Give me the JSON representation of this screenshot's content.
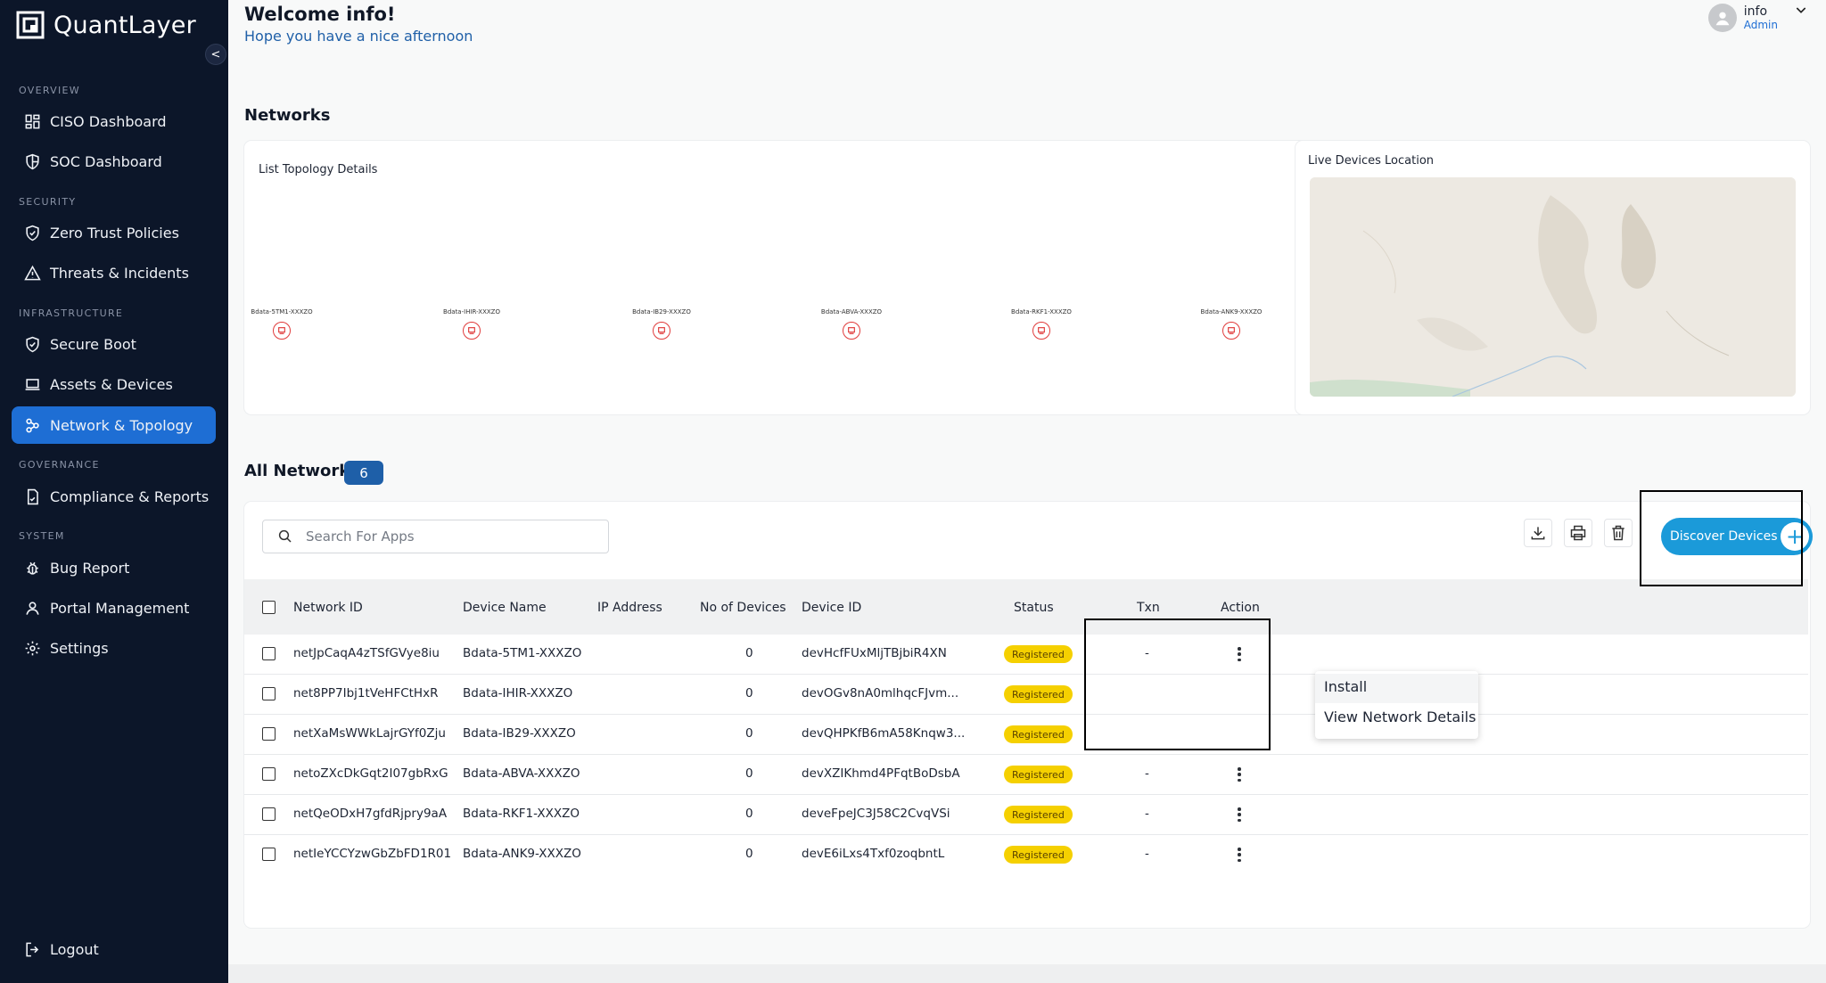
{
  "app": {
    "name": "QuantLayer",
    "collapse_glyph": "<"
  },
  "sidebar": {
    "sections": [
      {
        "label": "OVERVIEW",
        "items": [
          {
            "label": "CISO Dashboard",
            "icon": "dashboard-grid-icon"
          },
          {
            "label": "SOC Dashboard",
            "icon": "shield-half-icon"
          }
        ]
      },
      {
        "label": "SECURITY",
        "items": [
          {
            "label": "Zero Trust Policies",
            "icon": "shield-check-icon"
          },
          {
            "label": "Threats & Incidents",
            "icon": "warning-triangle-icon"
          }
        ]
      },
      {
        "label": "INFRASTRUCTURE",
        "items": [
          {
            "label": "Secure Boot",
            "icon": "shield-check-icon"
          },
          {
            "label": "Assets & Devices",
            "icon": "laptop-icon"
          },
          {
            "label": "Network & Topology",
            "icon": "network-icon",
            "active": true
          }
        ]
      },
      {
        "label": "GOVERNANCE",
        "items": [
          {
            "label": "Compliance & Reports",
            "icon": "report-file-icon"
          }
        ]
      },
      {
        "label": "SYSTEM",
        "items": [
          {
            "label": "Bug Report",
            "icon": "bug-icon"
          },
          {
            "label": "Portal Management",
            "icon": "user-icon"
          },
          {
            "label": "Settings",
            "icon": "gear-icon"
          }
        ]
      }
    ],
    "logout_label": "Logout"
  },
  "header": {
    "welcome": "Welcome info!",
    "subtitle": "Hope you have a nice afternoon",
    "user_name": "info",
    "user_role": "Admin"
  },
  "networks_title": "Networks",
  "topology": {
    "title": "List Topology Details",
    "nodes": [
      "Bdata-5TM1-XXXZO",
      "Bdata-IHIR-XXXZO",
      "Bdata-IB29-XXXZO",
      "Bdata-ABVA-XXXZO",
      "Bdata-RKF1-XXXZO",
      "Bdata-ANK9-XXXZO"
    ]
  },
  "map": {
    "title": "Live Devices Location"
  },
  "all_networks": {
    "title": "All Networks",
    "count": "6",
    "search_placeholder": "Search For Apps",
    "discover_label": "Discover Devices",
    "columns": [
      "Network ID",
      "Device Name",
      "IP Address",
      "No of Devices",
      "Device ID",
      "Status",
      "Txn",
      "Action"
    ],
    "rows": [
      {
        "network_id": "netJpCaqA4zTSfGVye8iu",
        "device_name": "Bdata-5TM1-XXXZO",
        "ip": "",
        "devices": "0",
        "device_id": "devHcfFUxMljTBjbiR4XN",
        "status": "Registered",
        "txn": "-"
      },
      {
        "network_id": "net8PP7Ibj1tVeHFCtHxR",
        "device_name": "Bdata-IHIR-XXXZO",
        "ip": "",
        "devices": "0",
        "device_id": "devOGv8nA0mlhqcFJvm...",
        "status": "Registered",
        "txn": ""
      },
      {
        "network_id": "netXaMsWWkLajrGYf0Zju",
        "device_name": "Bdata-IB29-XXXZO",
        "ip": "",
        "devices": "0",
        "device_id": "devQHPKfB6mA58Knqw3...",
        "status": "Registered",
        "txn": ""
      },
      {
        "network_id": "netoZXcDkGqt2I07gbRxG",
        "device_name": "Bdata-ABVA-XXXZO",
        "ip": "",
        "devices": "0",
        "device_id": "devXZIKhmd4PFqtBoDsbA",
        "status": "Registered",
        "txn": "-"
      },
      {
        "network_id": "netQeODxH7gfdRjpry9aA",
        "device_name": "Bdata-RKF1-XXXZO",
        "ip": "",
        "devices": "0",
        "device_id": "deveFpeJC3J58C2CvqVSi",
        "status": "Registered",
        "txn": "-"
      },
      {
        "network_id": "netIeYCCYzwGbZbFD1R01",
        "device_name": "Bdata-ANK9-XXXZO",
        "ip": "",
        "devices": "0",
        "device_id": "devE6iLxs4Txf0zoqbntL",
        "status": "Registered",
        "txn": "-"
      }
    ]
  },
  "action_menu": {
    "items": [
      "Install",
      "View Network Details"
    ]
  },
  "colors": {
    "sidebar_bg": "#0c1629",
    "accent": "#1e6ed4",
    "status_registered": "#f5d000",
    "discover_btn": "#1b9ad9"
  }
}
